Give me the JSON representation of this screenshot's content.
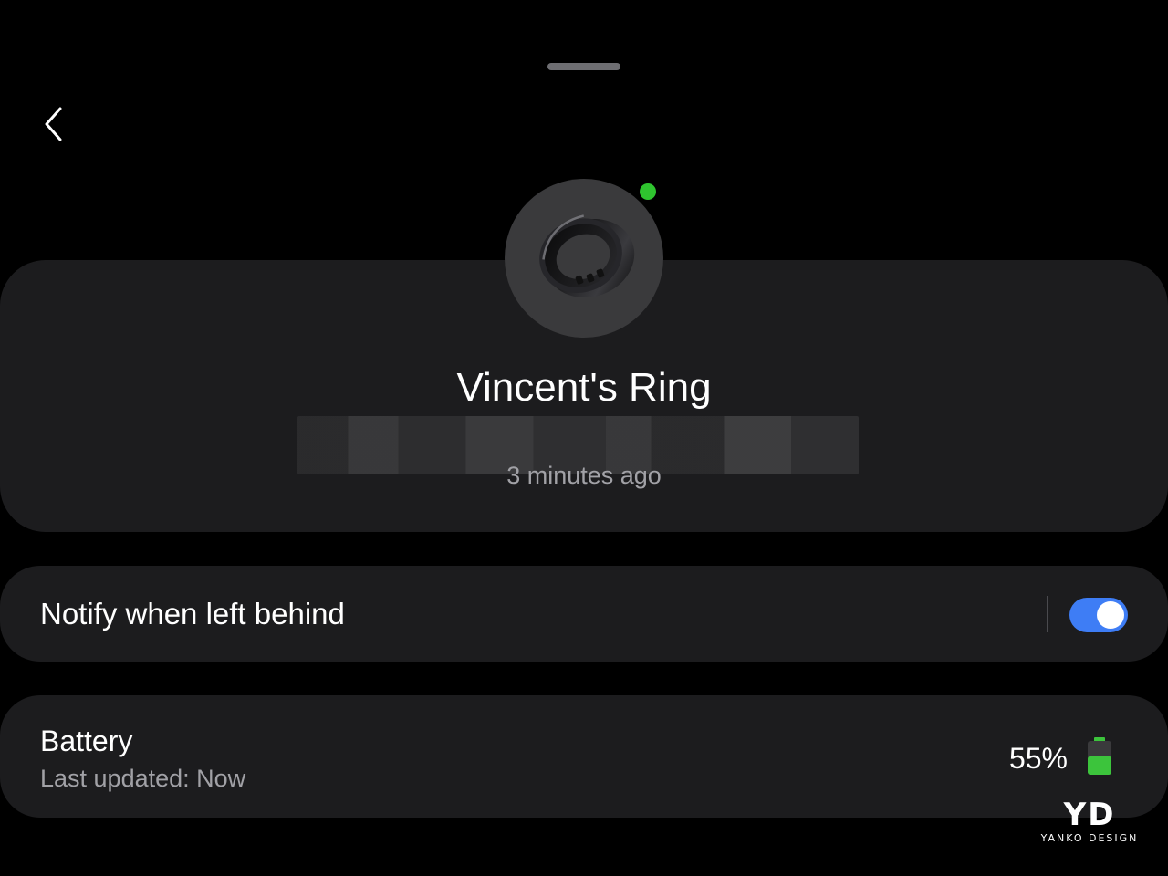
{
  "device": {
    "name": "Vincent's Ring",
    "last_seen": "3 minutes ago",
    "status_color": "#2fc42f",
    "icon": "ring-icon"
  },
  "notify": {
    "label": "Notify when left behind",
    "enabled": true,
    "toggle_color": "#3e7df5"
  },
  "battery": {
    "title": "Battery",
    "subtitle": "Last updated: Now",
    "percent_label": "55%",
    "level": 0.55,
    "color": "#3cc43c"
  },
  "watermark": {
    "logo": "YD",
    "text": "YANKO DESIGN"
  },
  "icons": {
    "back": "chevron-left-icon",
    "battery": "battery-icon"
  }
}
